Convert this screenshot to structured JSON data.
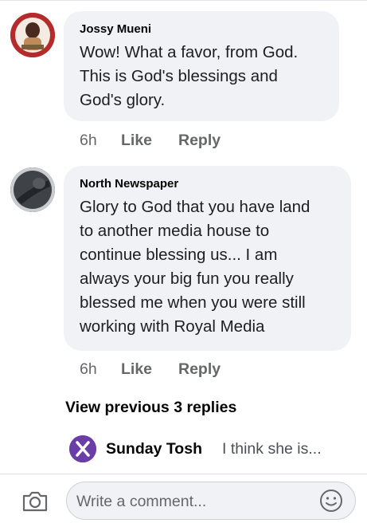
{
  "comments": [
    {
      "author": "Jossy Mueni",
      "text": "Wow! What a favor, from God.\nThis is God's blessings and\nGod's glory.",
      "time": "6h",
      "like_label": "Like",
      "reply_label": "Reply"
    },
    {
      "author": "North Newspaper",
      "text": "Glory to God that you have land\nto another media house to\ncontinue blessing us... I am\nalways your big fun you really\nblessed me when you were still\nworking with Royal Media",
      "time": "6h",
      "like_label": "Like",
      "reply_label": "Reply"
    }
  ],
  "view_previous_label": "View previous 3 replies",
  "latest_reply": {
    "author": "Sunday Tosh",
    "snippet": "I think she is..."
  },
  "composer": {
    "placeholder": "Write a comment..."
  },
  "icons": {
    "camera": "camera-icon",
    "emoji": "smiley-icon"
  },
  "colors": {
    "bubble": "#f0f2f5",
    "meta_text": "#65676b",
    "reply_avatar": "#6a3ea6"
  }
}
